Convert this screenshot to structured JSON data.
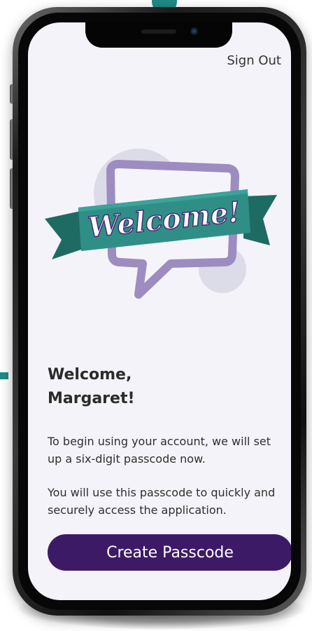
{
  "header": {
    "sign_out_label": "Sign Out"
  },
  "hero": {
    "banner_text": "Welcome!"
  },
  "greeting": {
    "line1": "Welcome,",
    "line2": "Margaret!"
  },
  "body": {
    "paragraph1": "To begin using your account, we will set up a six-digit passcode now.",
    "paragraph2": "You will use this passcode to quickly and securely access the application."
  },
  "cta": {
    "label": "Create Passcode"
  },
  "colors": {
    "primary_button": "#3d1a66",
    "ribbon": "#2f8f87",
    "ribbon_dark": "#1e6b64",
    "speech_bubble": "#9d8cc0",
    "screen_background": "#f4f3f9"
  }
}
